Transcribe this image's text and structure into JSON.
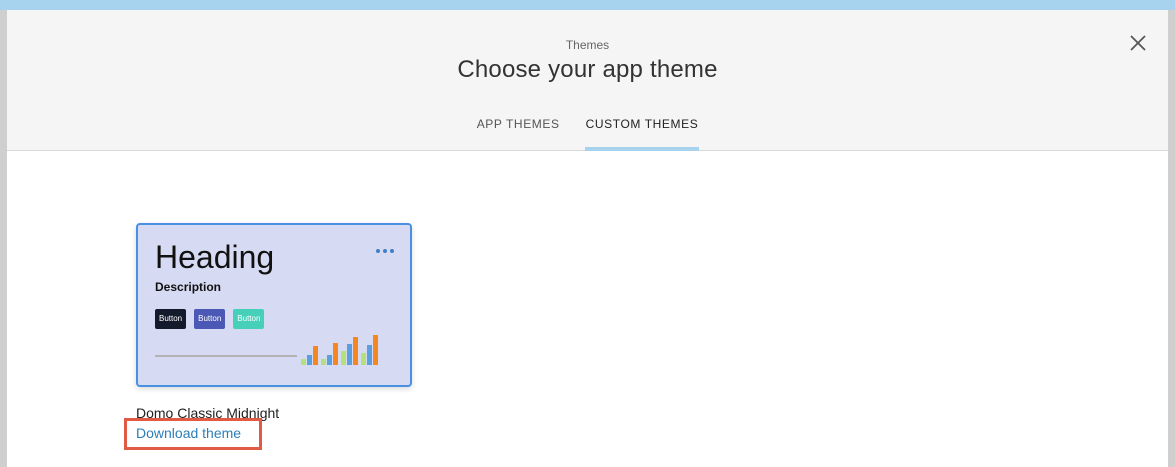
{
  "header": {
    "eyebrow": "Themes",
    "title": "Choose your app theme"
  },
  "tabs": [
    {
      "label": "APP THEMES",
      "active": false
    },
    {
      "label": "CUSTOM THEMES",
      "active": true
    }
  ],
  "theme_card": {
    "heading": "Heading",
    "description": "Description",
    "buttons": [
      "Button",
      "Button",
      "Button"
    ],
    "colors": {
      "card_background": "#d6dbf3",
      "card_border": "#4a90e2",
      "button_dark": "#131a2b",
      "button_primary": "#4b58b5",
      "button_accent": "#46d0b9",
      "bar_green": "#b3e17a",
      "bar_blue": "#5b9fde",
      "bar_orange": "#f58620"
    },
    "name": "Domo Classic Midnight",
    "download_label": "Download theme"
  },
  "icons": {
    "close": "close-icon",
    "more": "more-horizontal-icon"
  },
  "colors": {
    "accent_tab_underline": "#a7d3ef",
    "link": "#2b7fb8",
    "highlight": "#e05a44"
  }
}
